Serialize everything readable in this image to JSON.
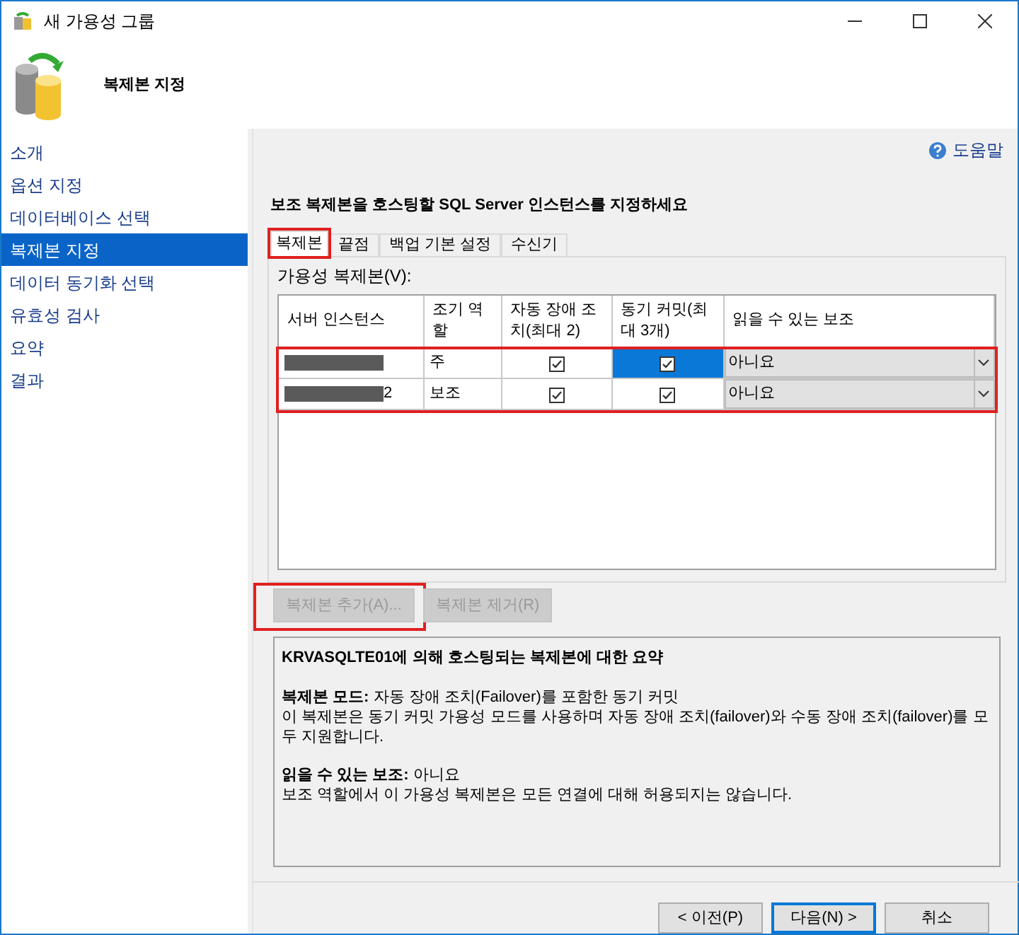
{
  "window": {
    "title": "새 가용성 그룹"
  },
  "header": {
    "title": "복제본 지정"
  },
  "sidebar": {
    "items": [
      {
        "label": "소개",
        "selected": false
      },
      {
        "label": "옵션 지정",
        "selected": false
      },
      {
        "label": "데이터베이스 선택",
        "selected": false
      },
      {
        "label": "복제본 지정",
        "selected": true
      },
      {
        "label": "데이터 동기화 선택",
        "selected": false
      },
      {
        "label": "유효성 검사",
        "selected": false
      },
      {
        "label": "요약",
        "selected": false
      },
      {
        "label": "결과",
        "selected": false
      }
    ]
  },
  "help_link": "도움말",
  "instruction": "보조 복제본을 호스팅할 SQL Server 인스턴스를 지정하세요",
  "tabs": [
    {
      "label": "복제본",
      "selected": true,
      "highlighted": true
    },
    {
      "label": "끝점",
      "selected": false,
      "highlighted": false
    },
    {
      "label": "백업 기본 설정",
      "selected": false,
      "highlighted": false
    },
    {
      "label": "수신기",
      "selected": false,
      "highlighted": false
    }
  ],
  "replicas_label": "가용성 복제본(V):",
  "table": {
    "columns": [
      "서버 인스턴스",
      "조기 역할",
      "자동 장애 조치(최대 2)",
      "동기 커밋(최대 3개)",
      "읽을 수 있는 보조"
    ],
    "rows_highlighted": true,
    "rows": [
      {
        "server": "",
        "redacted": true,
        "role": "주",
        "auto_failover": true,
        "sync_commit": true,
        "sync_commit_focused": true,
        "readable": "아니요"
      },
      {
        "server": "2",
        "redacted": true,
        "role": "보조",
        "auto_failover": true,
        "sync_commit": true,
        "sync_commit_focused": false,
        "readable": "아니요"
      }
    ]
  },
  "buttons": [
    {
      "label": "복제본 추가(A)...",
      "disabled": true,
      "highlighted": true
    },
    {
      "label": "복제본 제거(R)",
      "disabled": true,
      "highlighted": false
    }
  ],
  "summary": {
    "title": "KRVASQLTE01에 의해 호스팅되는 복제본에 대한 요약",
    "paragraphs": [
      "**복제본 모드:** 자동 장애 조치(Failover)를 포함한 동기 커밋\n이 복제본은 동기 커밋 가용성 모드를 사용하며 자동 장애 조치(failover)와 수동 장애 조치(failover)를 모두 지원합니다.",
      "**읽을 수 있는 보조:** 아니요\n보조 역할에서 이 가용성 복제본은 모든 연결에 대해 허용되지는 않습니다."
    ]
  },
  "footer_buttons": [
    {
      "label": "< 이전(P)",
      "default": false
    },
    {
      "label": "다음(N) >",
      "default": true
    },
    {
      "label": "취소",
      "default": false
    }
  ]
}
